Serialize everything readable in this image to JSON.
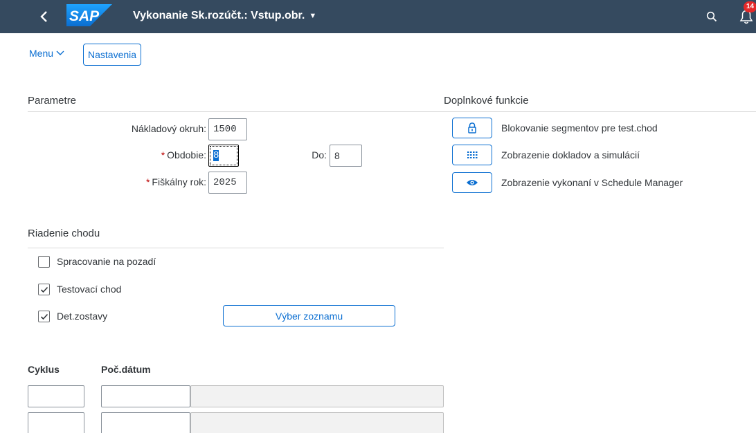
{
  "shell": {
    "title": "Vykonanie Sk.rozúčt.: Vstup.obr.",
    "title_caret": "▼",
    "logo_text": "SAP",
    "notification_count": "14",
    "icons": [
      "back-icon",
      "search-icon",
      "bell-icon"
    ],
    "bar_color": "#354a5f"
  },
  "toolbar": {
    "menu_label": "Menu",
    "nastavenia_label": "Nastavenia"
  },
  "parametre": {
    "title": "Parametre",
    "nakladovy_okruh_label": "Nákladový okruh:",
    "nakladovy_okruh_value": "1500",
    "obdobie_label": "Obdobie:",
    "obdobie_value": "8",
    "do_label": "Do:",
    "do_value": "8",
    "fiskalny_rok_label": "Fiškálny rok:",
    "fiskalny_rok_value": "2025",
    "required_marker": "*"
  },
  "doplnkove": {
    "title": "Doplnkové funkcie",
    "items": [
      {
        "label": "Blokovanie segmentov pre test.chod",
        "icon": "lock-icon"
      },
      {
        "label": "Zobrazenie dokladov a simulácií",
        "icon": "grid-icon"
      },
      {
        "label": "Zobrazenie vykonaní v Schedule Manager",
        "icon": "eye-icon"
      }
    ]
  },
  "riadenie": {
    "title": "Riadenie chodu",
    "checkboxes": [
      {
        "label": "Spracovanie na pozadí",
        "checked": false
      },
      {
        "label": "Testovací chod",
        "checked": true
      },
      {
        "label": "Det.zostavy",
        "checked": true
      }
    ],
    "vyber_button": "Výber zoznamu"
  },
  "table": {
    "headers": [
      "Cyklus",
      "Poč.dátum"
    ],
    "rows": [
      {
        "cyklus": "",
        "pocdatum": "",
        "desc": ""
      },
      {
        "cyklus": "",
        "pocdatum": "",
        "desc": ""
      }
    ]
  },
  "colors": {
    "accent": "#0a6ed1",
    "required": "#bb0000",
    "badge": "#e52929"
  }
}
